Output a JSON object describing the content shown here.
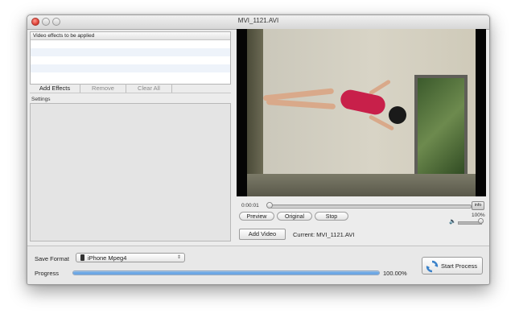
{
  "window": {
    "title": "MVI_1121.AVI"
  },
  "effects": {
    "header": "Video effects to be applied",
    "buttons": {
      "add": "Add Effects",
      "remove": "Remove",
      "clear": "Clear All"
    }
  },
  "settings": {
    "label": "Settings"
  },
  "player": {
    "time": "0:00:01",
    "info_label": "info",
    "preview": "Preview",
    "original": "Original",
    "stop": "Stop",
    "volume": "100%",
    "seek_position": 0.0
  },
  "source": {
    "add_video": "Add Video",
    "current": "Current: MVI_1121.AVI"
  },
  "output": {
    "save_format_label": "Save Format",
    "format": "iPhone Mpeg4",
    "progress_label": "Progress",
    "progress_value": 100,
    "progress_text": "100.00%",
    "start": "Start Process"
  },
  "icons": [
    "close-icon",
    "minimize-icon",
    "zoom-icon",
    "speaker-icon",
    "phone-icon",
    "refresh-icon"
  ],
  "colors": {
    "accent": "#5e9ee0",
    "close": "#e0443a",
    "swimsuit": "#c8204a"
  }
}
